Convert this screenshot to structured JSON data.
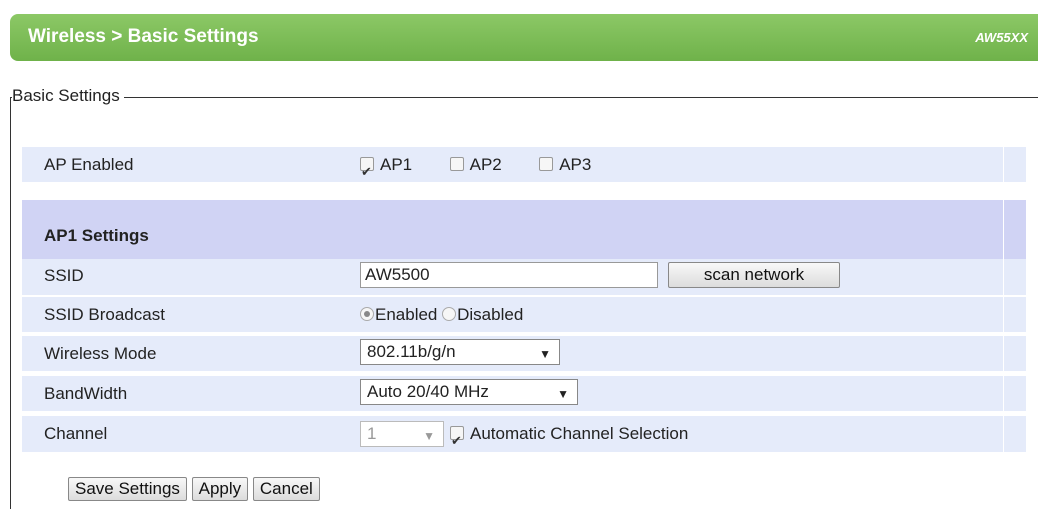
{
  "header": {
    "title": "Wireless > Basic Settings",
    "model": "AW55XX"
  },
  "section": {
    "legend": "Basic Settings"
  },
  "ap_enabled": {
    "label": "AP Enabled",
    "options": [
      {
        "label": "AP1",
        "checked": true
      },
      {
        "label": "AP2",
        "checked": false
      },
      {
        "label": "AP3",
        "checked": false
      }
    ]
  },
  "ap1": {
    "heading": "AP1 Settings",
    "ssid": {
      "label": "SSID",
      "value": "AW5500",
      "scan_label": "scan network"
    },
    "ssid_broadcast": {
      "label": "SSID Broadcast",
      "enabled_label": "Enabled",
      "disabled_label": "Disabled",
      "selected": "Enabled"
    },
    "wireless_mode": {
      "label": "Wireless Mode",
      "value": "802.11b/g/n"
    },
    "bandwidth": {
      "label": "BandWidth",
      "value": "Auto 20/40 MHz"
    },
    "channel": {
      "label": "Channel",
      "value": "1",
      "auto_label": "Automatic Channel Selection",
      "auto_checked": true
    }
  },
  "buttons": {
    "save": "Save Settings",
    "apply": "Apply",
    "cancel": "Cancel"
  }
}
